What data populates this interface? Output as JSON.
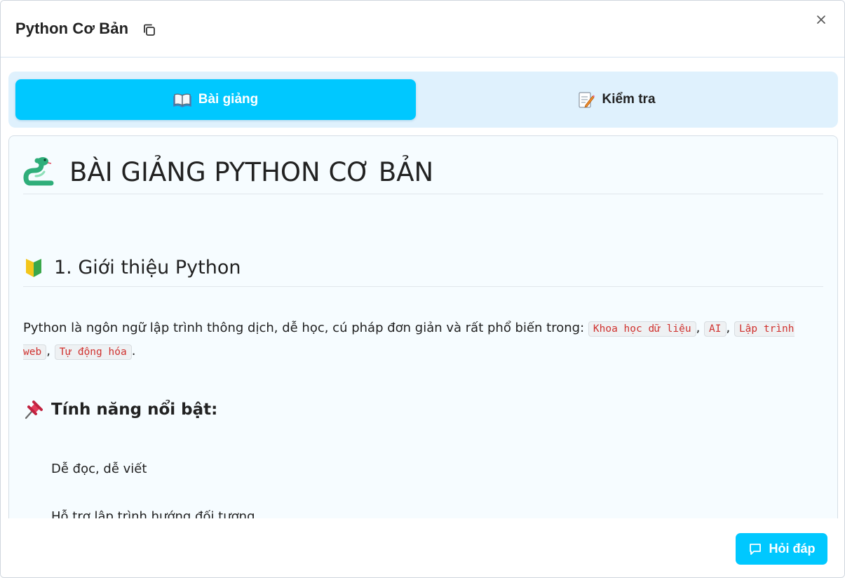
{
  "dialog": {
    "title": "Python Cơ Bản",
    "icons": {
      "copy": "copy-icon",
      "close": "close-icon"
    }
  },
  "tabs": [
    {
      "label": "Bài giảng",
      "icon": "book-icon",
      "active": true
    },
    {
      "label": "Kiểm tra",
      "icon": "memo-icon",
      "active": false
    }
  ],
  "lesson": {
    "heading": "BÀI GIẢNG PYTHON CƠ BẢN",
    "heading_icon": "snake-icon",
    "section1_title": "1. Giới thiệu Python",
    "section1_icon": "beginner-icon",
    "intro_text": "Python là ngôn ngữ lập trình thông dịch, dễ học, cú pháp đơn giản và rất phổ biến trong:",
    "intro_tags": [
      "Khoa học dữ liệu",
      "AI",
      "Lập trình web",
      "Tự động hóa"
    ],
    "features_title": "Tính năng nổi bật:",
    "features_icon": "pushpin-icon",
    "features": [
      "Dễ đọc, dễ viết",
      "Hỗ trợ lập trình hướng đối tượng"
    ]
  },
  "footer": {
    "ask_button": "Hỏi đáp",
    "ask_icon": "chat-icon"
  },
  "colors": {
    "accent": "#00c8ff",
    "tabs_bg": "#dff1fd",
    "content_bg": "#f6fcff",
    "code_text": "#d0322f"
  }
}
